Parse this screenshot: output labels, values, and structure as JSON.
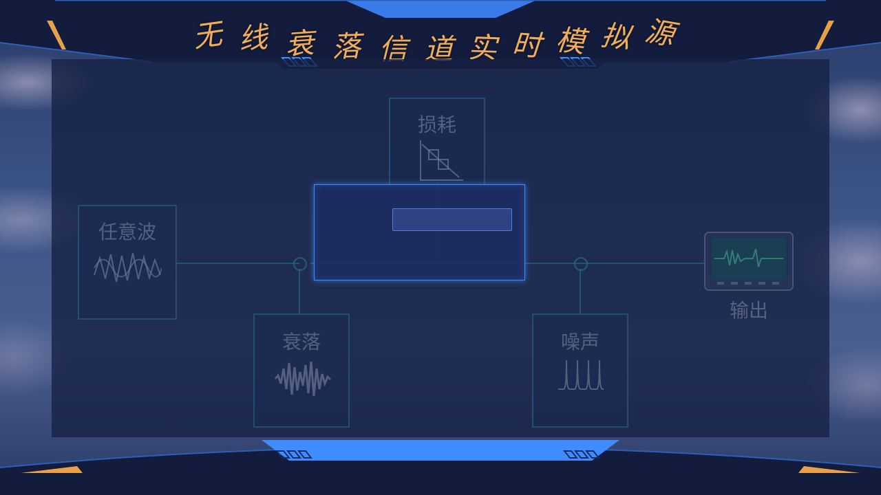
{
  "header": {
    "title_chars": [
      "无",
      "线",
      "衰",
      "落",
      "信",
      "道",
      "实",
      "时",
      "模",
      "拟",
      "源"
    ]
  },
  "diagram": {
    "blocks": {
      "arbitrary_wave": "任意波",
      "loss": "损耗",
      "fading": "衰落",
      "noise": "噪声",
      "output": "输出"
    }
  },
  "dialog": {
    "input_value": "",
    "input_placeholder": ""
  },
  "colors": {
    "title": "#f0ad5c",
    "accent_blue": "#3f8cff",
    "frame_dark": "#121b3a",
    "panel": "#162042",
    "orange_trim": "#e8a04a"
  }
}
